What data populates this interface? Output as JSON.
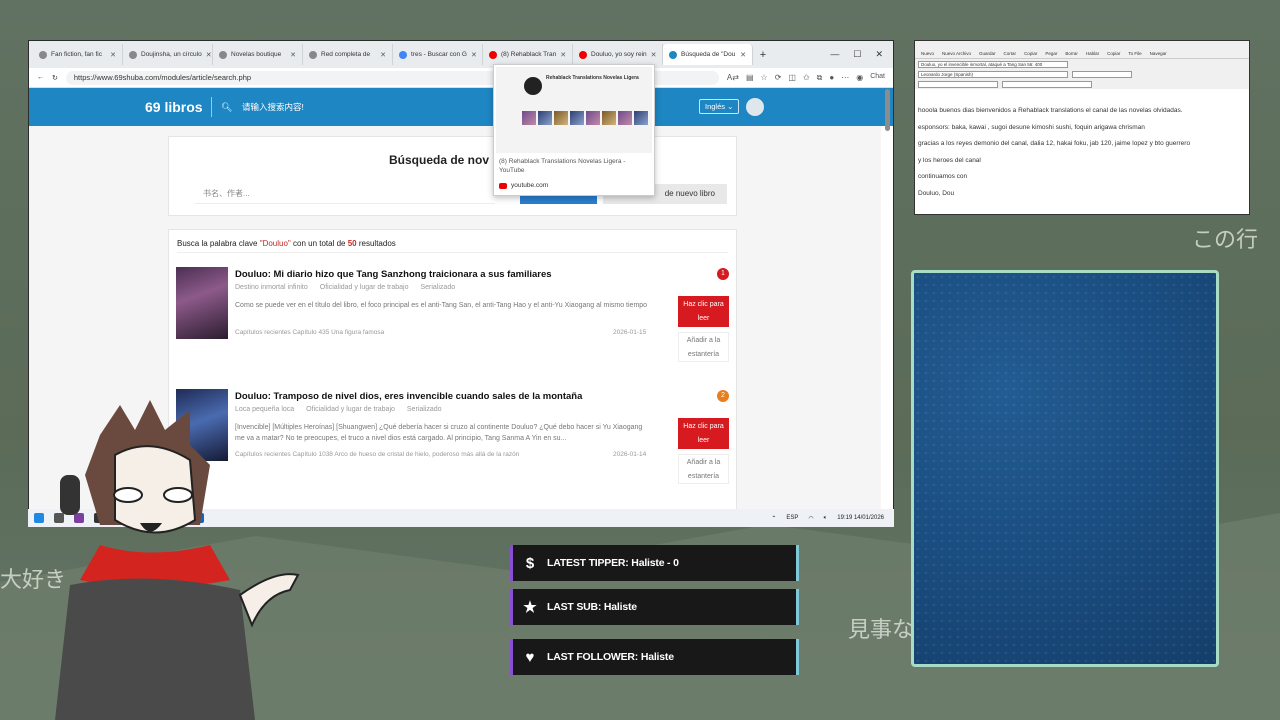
{
  "background": {
    "jp_texts": [
      "大好き",
      "見事な",
      "この行"
    ]
  },
  "browser": {
    "tabs": [
      {
        "label": "Fan fiction, fan fic",
        "active": false
      },
      {
        "label": "Doujinsha, un círculo",
        "active": false
      },
      {
        "label": "Novelas boutique",
        "active": false
      },
      {
        "label": "Red completa de",
        "active": false
      },
      {
        "label": "tres - Buscar con G",
        "active": false
      },
      {
        "label": "(8) Rehablack Tran",
        "active": false
      },
      {
        "label": "Douluo, yo soy rein",
        "active": false
      },
      {
        "label": "Búsqueda de \"Dou",
        "active": true
      }
    ],
    "new_tab": "+",
    "url": "https://www.69shuba.com/modules/article/search.php",
    "chat_label": "Chat"
  },
  "site": {
    "logo": "69 libros",
    "search_placeholder": "请输入搜索内容!",
    "language": "Inglés",
    "search_title": "Búsqueda de nov",
    "input_placeholder": "书名、作者...",
    "new_book_label": "de nuevo libro"
  },
  "results": {
    "prefix": "Busca la palabra clave",
    "keyword": "\"Douluo\"",
    "middle": "con un total de",
    "count": "50",
    "suffix": "resultados",
    "books": [
      {
        "title": "Douluo: Mi diario hizo que Tang Sanzhong traicionara a sus familiares",
        "author": "Destino inmortal infinito",
        "category": "Oficialidad y lugar de trabajo",
        "status": "Serializado",
        "desc": "Como se puede ver en el título del libro, el foco principal es el anti-Tang San, el anti-Tang Hao y el anti-Yu Xiaogang al mismo tiempo",
        "latest": "Capítulos recientes  Capítulo 435 Una figura famosa",
        "date": "2026-01-15",
        "rank": "1",
        "rank_color": "#d71920",
        "read_label": "Haz clic para leer",
        "shelf_label": "Añadir a la estantería"
      },
      {
        "title": "Douluo: Tramposo de nivel dios, eres invencible cuando sales de la montaña",
        "author": "Loca pequeña loca",
        "category": "Oficialidad y lugar de trabajo",
        "status": "Serializado",
        "desc": "[Invencible] [Múltiples Heroínas] [Shuangwen] ¿Qué debería hacer si cruzo al continente Douluo? ¿Qué debo hacer si Yu Xiaogang me va a matar? No te preocupes, el truco a nivel dios está cargado. Al principio, Tang Sanma A Yin en su...",
        "latest": "Capítulos recientes  Capítulo 1038 Arco de hueso de cristal de hielo, poderoso más allá de la razón",
        "date": "2026-01-14",
        "rank": "2",
        "rank_color": "#e67e22",
        "read_label": "Haz clic para leer",
        "shelf_label": "Añadir a la estantería"
      }
    ]
  },
  "youtube_popup": {
    "channel": "Rehablack Translations Novelas Ligera",
    "title": "(8) Rehablack Translations Novelas Ligera - YouTube",
    "domain": "youtube.com"
  },
  "taskbar": {
    "lang": "ESP",
    "time": "19:19",
    "date": "14/01/2026"
  },
  "translator": {
    "toolbar": [
      "Nuevo",
      "Nuevo Archivo",
      "Guardar",
      "Cortar",
      "Copiar",
      "Pegar",
      "Borrar",
      "Hablar",
      "Copiar",
      "To File",
      "Navegar"
    ],
    "title_field": "Douluo, yo el invencible inmortal, ataqué a Tang San 56: 400",
    "voice": "Leonardo Jorge (Spanish)",
    "lines": [
      "hooola buenos dias bienvenidos a Rehablack translations el canal de las novelas olvidadas.",
      "esponsors: baka, kawai , sugoi desune kimoshi sushi, foquin arigawa chrisman",
      "gracias a los reyes demonio del canal, dalia 12, hakai foku, jab 120, jaime lopez y bto guerrero",
      "y los heroes del canal",
      "continuamos con",
      "Douluo, Dou"
    ]
  },
  "alerts": [
    {
      "icon": "$",
      "label": "LATEST TIPPER: Haliste - 0"
    },
    {
      "icon": "★",
      "label": "LAST SUB: Haliste"
    },
    {
      "icon": "♥",
      "label": "LAST FOLLOWER: Haliste"
    }
  ],
  "colors": {
    "site_blue": "#1e86c3",
    "read_red": "#d71920",
    "alert_purple": "#8a4dd6",
    "alert_cyan": "#7ec8d8"
  }
}
